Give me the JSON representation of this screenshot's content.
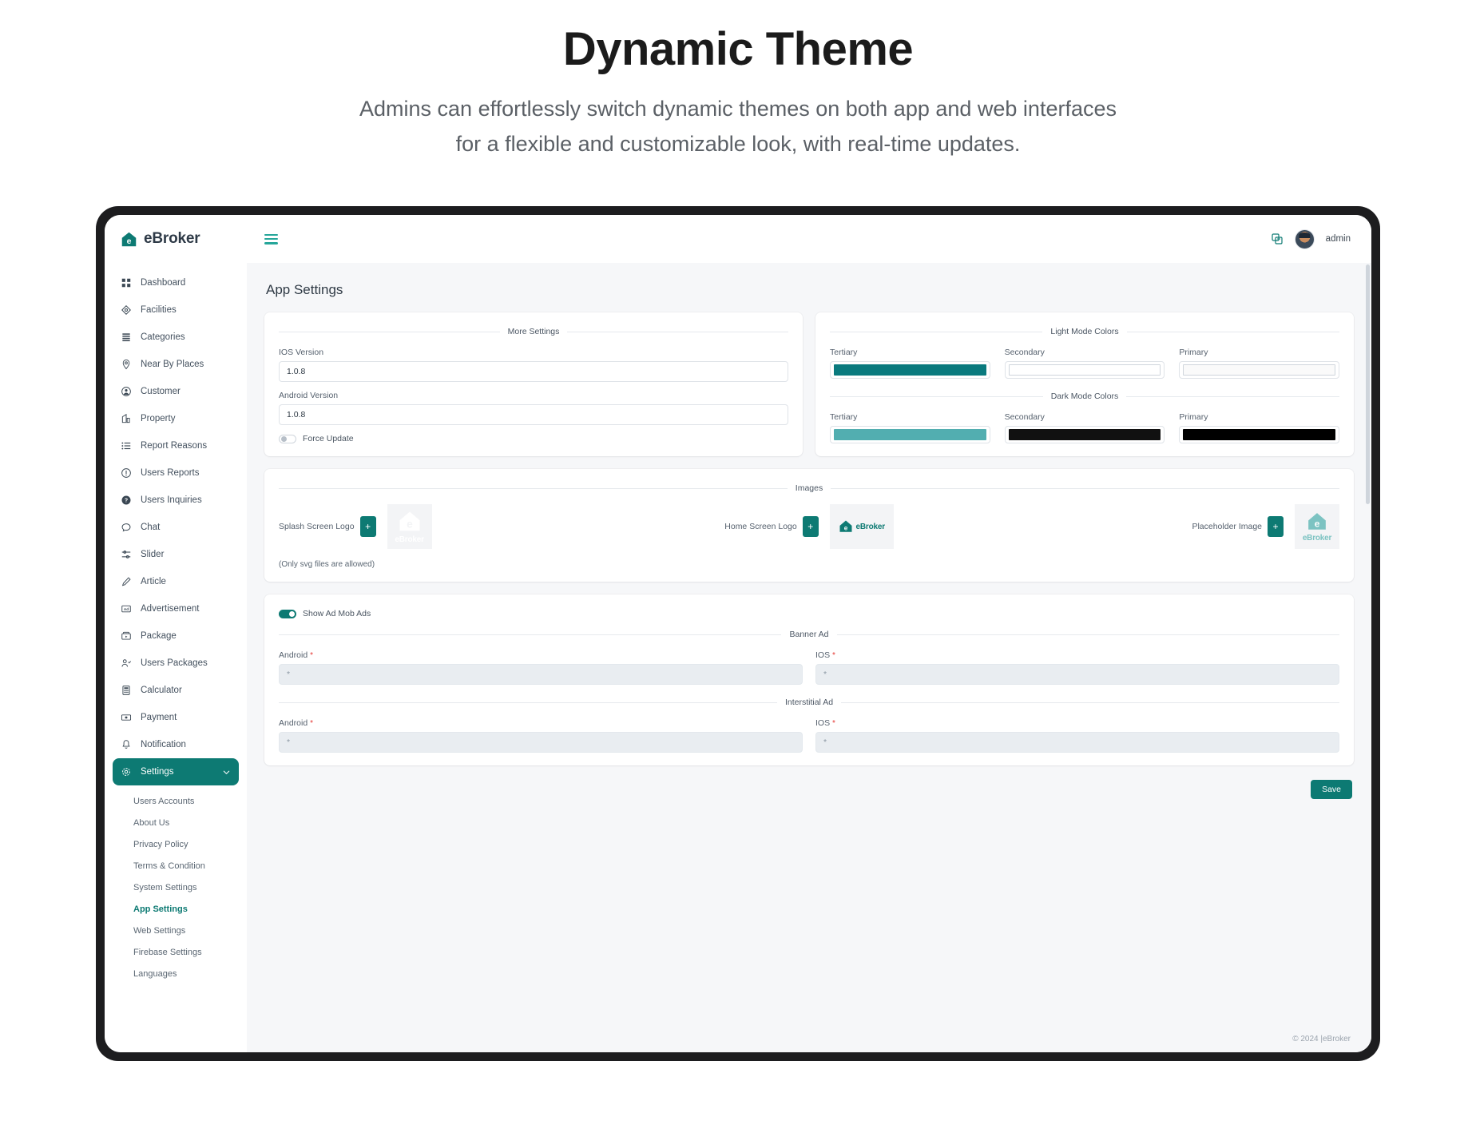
{
  "promo": {
    "title": "Dynamic Theme",
    "subtitle_line1": "Admins can effortlessly switch dynamic themes on both app and web interfaces",
    "subtitle_line2": "for a flexible and customizable look, with real-time updates."
  },
  "brand": {
    "name": "eBroker"
  },
  "topbar": {
    "username": "admin"
  },
  "sidebar": {
    "items": [
      {
        "label": "Dashboard",
        "icon": "grid-icon"
      },
      {
        "label": "Facilities",
        "icon": "diamond-icon"
      },
      {
        "label": "Categories",
        "icon": "layers-icon"
      },
      {
        "label": "Near By Places",
        "icon": "map-pin-icon"
      },
      {
        "label": "Customer",
        "icon": "user-circle-icon"
      },
      {
        "label": "Property",
        "icon": "chart-icon"
      },
      {
        "label": "Report Reasons",
        "icon": "list-icon"
      },
      {
        "label": "Users Reports",
        "icon": "alert-circle-icon"
      },
      {
        "label": "Users Inquiries",
        "icon": "question-circle-icon"
      },
      {
        "label": "Chat",
        "icon": "chat-bubble-icon"
      },
      {
        "label": "Slider",
        "icon": "sliders-icon"
      },
      {
        "label": "Article",
        "icon": "pen-icon"
      },
      {
        "label": "Advertisement",
        "icon": "ad-icon"
      },
      {
        "label": "Package",
        "icon": "package-icon"
      },
      {
        "label": "Users Packages",
        "icon": "user-check-icon"
      },
      {
        "label": "Calculator",
        "icon": "calculator-icon"
      },
      {
        "label": "Payment",
        "icon": "payment-icon"
      },
      {
        "label": "Notification",
        "icon": "bell-icon"
      }
    ],
    "settings": {
      "label": "Settings",
      "icon": "gear-icon",
      "chevron": "chevron-down-icon"
    },
    "sub_items": [
      {
        "label": "Users Accounts",
        "active": false
      },
      {
        "label": "About Us",
        "active": false
      },
      {
        "label": "Privacy Policy",
        "active": false
      },
      {
        "label": "Terms & Condition",
        "active": false
      },
      {
        "label": "System Settings",
        "active": false
      },
      {
        "label": "App Settings",
        "active": true
      },
      {
        "label": "Web Settings",
        "active": false
      },
      {
        "label": "Firebase Settings",
        "active": false
      },
      {
        "label": "Languages",
        "active": false
      }
    ]
  },
  "page": {
    "title": "App Settings"
  },
  "more_settings": {
    "legend": "More Settings",
    "ios_version_label": "IOS Version",
    "ios_version_value": "1.0.8",
    "android_version_label": "Android Version",
    "android_version_value": "1.0.8",
    "force_update_label": "Force Update",
    "force_update_on": false
  },
  "colors": {
    "light_legend": "Light Mode Colors",
    "dark_legend": "Dark Mode Colors",
    "light": [
      {
        "label": "Tertiary",
        "value": "#0a7a7e"
      },
      {
        "label": "Secondary",
        "value": "#ffffff"
      },
      {
        "label": "Primary",
        "value": "#fafafa"
      }
    ],
    "dark": [
      {
        "label": "Tertiary",
        "value": "#52aeb0"
      },
      {
        "label": "Secondary",
        "value": "#111111"
      },
      {
        "label": "Primary",
        "value": "#000000"
      }
    ]
  },
  "images": {
    "legend": "Images",
    "splash_label": "Splash Screen Logo",
    "home_label": "Home Screen Logo",
    "placeholder_label": "Placeholder Image",
    "plus": "+",
    "preview_text": "eBroker",
    "note": "(Only svg files are allowed)"
  },
  "admob": {
    "toggle_label": "Show Ad Mob Ads",
    "toggle_on": true,
    "banner_legend": "Banner Ad",
    "interstitial_legend": "Interstitial Ad",
    "android_label": "Android",
    "ios_label": "IOS",
    "required_mark": "*",
    "banner_android_value": "*",
    "banner_ios_value": "*",
    "interstitial_android_value": "*",
    "interstitial_ios_value": "*"
  },
  "actions": {
    "save_label": "Save"
  },
  "footer": {
    "copyright": "© 2024 |eBroker"
  }
}
